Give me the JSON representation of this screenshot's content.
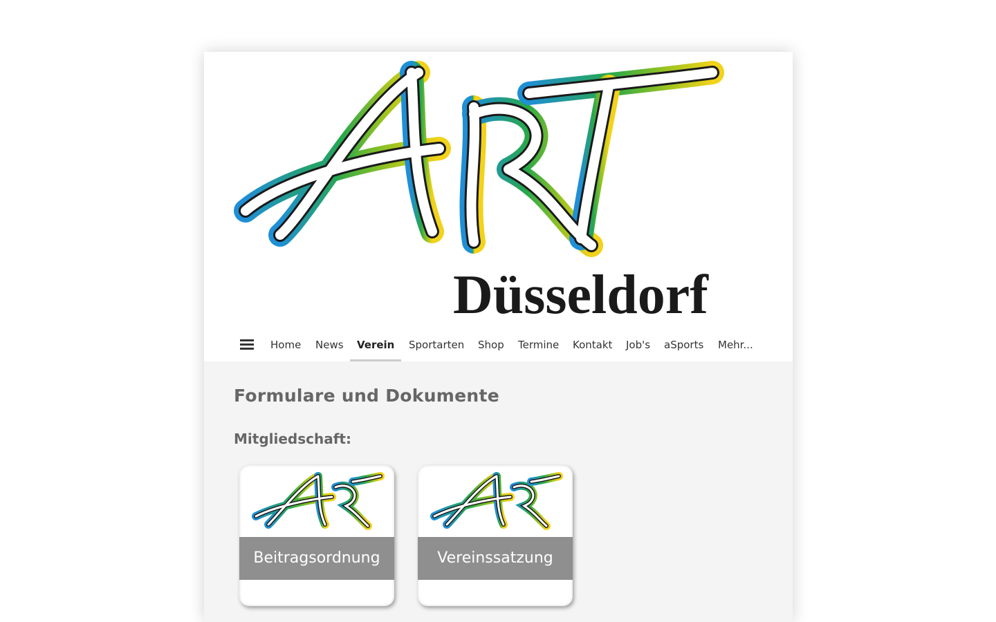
{
  "brand": {
    "logo_text": "ART",
    "city": "Düsseldorf",
    "colors": {
      "blue": "#1f8fd6",
      "green": "#27a84a",
      "yellow": "#f2d21a"
    }
  },
  "nav": {
    "menu_icon": "hamburger-icon",
    "items": [
      {
        "label": "Home",
        "active": false
      },
      {
        "label": "News",
        "active": false
      },
      {
        "label": "Verein",
        "active": true
      },
      {
        "label": "Sportarten",
        "active": false
      },
      {
        "label": "Shop",
        "active": false
      },
      {
        "label": "Termine",
        "active": false
      },
      {
        "label": "Kontakt",
        "active": false
      },
      {
        "label": "Job's",
        "active": false
      },
      {
        "label": "aSports",
        "active": false
      },
      {
        "label": "Mehr...",
        "active": false
      }
    ]
  },
  "content": {
    "title": "Formulare und Dokumente",
    "section_label": "Mitgliedschaft:",
    "documents": [
      {
        "logo_text": "ART",
        "label": "Beitragsordnung"
      },
      {
        "logo_text": "ART",
        "label": "Vereinssatzung"
      }
    ]
  }
}
